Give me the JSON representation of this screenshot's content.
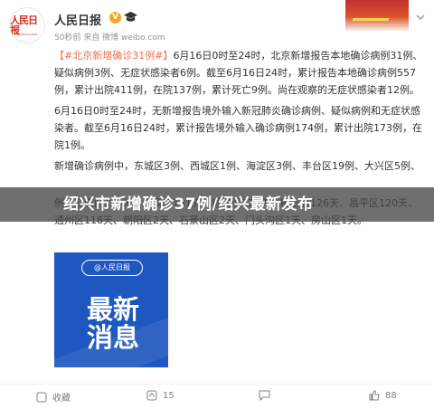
{
  "post": {
    "author": "人民日报",
    "avatar_text": "人民日报",
    "avatar_sub": "PEOPLE'S DAILY",
    "verified_badge": "V",
    "meta": "50秒前 来自 微博 weibo.com",
    "paragraphs": [
      {
        "topic": "【#北京新增确诊31例#】",
        "text": "6月16日0时至24时，北京新增报告本地确诊病例31例、疑似病例3例、无症状感染者6例。截至6月16日24时，累计报告本地确诊病例557例，累计出院411例，在院137例，累计死亡9例。尚在观察的无症状感染者12例。"
      },
      {
        "topic": "",
        "text": "6月16日0时至24时，无新增报告境外输入新冠肺炎确诊病例、疑似病例和无症状感染者。截至6月16日24时，累计报告境外输入确诊病例174例，累计出院173例，在院1例。"
      },
      {
        "topic": "",
        "text": "新增确诊病例中，东城区3例、西城区1例、海淀区3例、丰台区19例、大兴区5例、"
      },
      {
        "topic": "",
        "text": "...累计报告境外输入确诊病例174例中，东城区...西城区...朝阳区...海淀区...丰台区...石景山区...门头沟区...房山区...通州区...顺义区...昌平区...大兴区...怀柔区...平谷区...密云区...延庆区...本地报告病例"
      },
      {
        "topic": "",
        "text": "例、延庆区145天、怀柔区131天、顺义区129天、密云区126天、昌平区120天、通州区118天、朝阳区2天、石景山区2天、门头沟区1天、房山区1天。"
      }
    ],
    "overlay_headline": "绍兴市新增确诊37例/绍兴最新发布",
    "image": {
      "logo": "@人民日报",
      "logo_sub": "PEOPLE'S DAILY",
      "big_text_line1": "最新",
      "big_text_line2": "消息"
    },
    "actions": {
      "favorite": "收藏",
      "repost": "15",
      "comment": "",
      "like": "88"
    }
  },
  "colors": {
    "topic": "#eb7350",
    "brand_red": "#d52b1e",
    "image_blue": "#1f57c0"
  }
}
